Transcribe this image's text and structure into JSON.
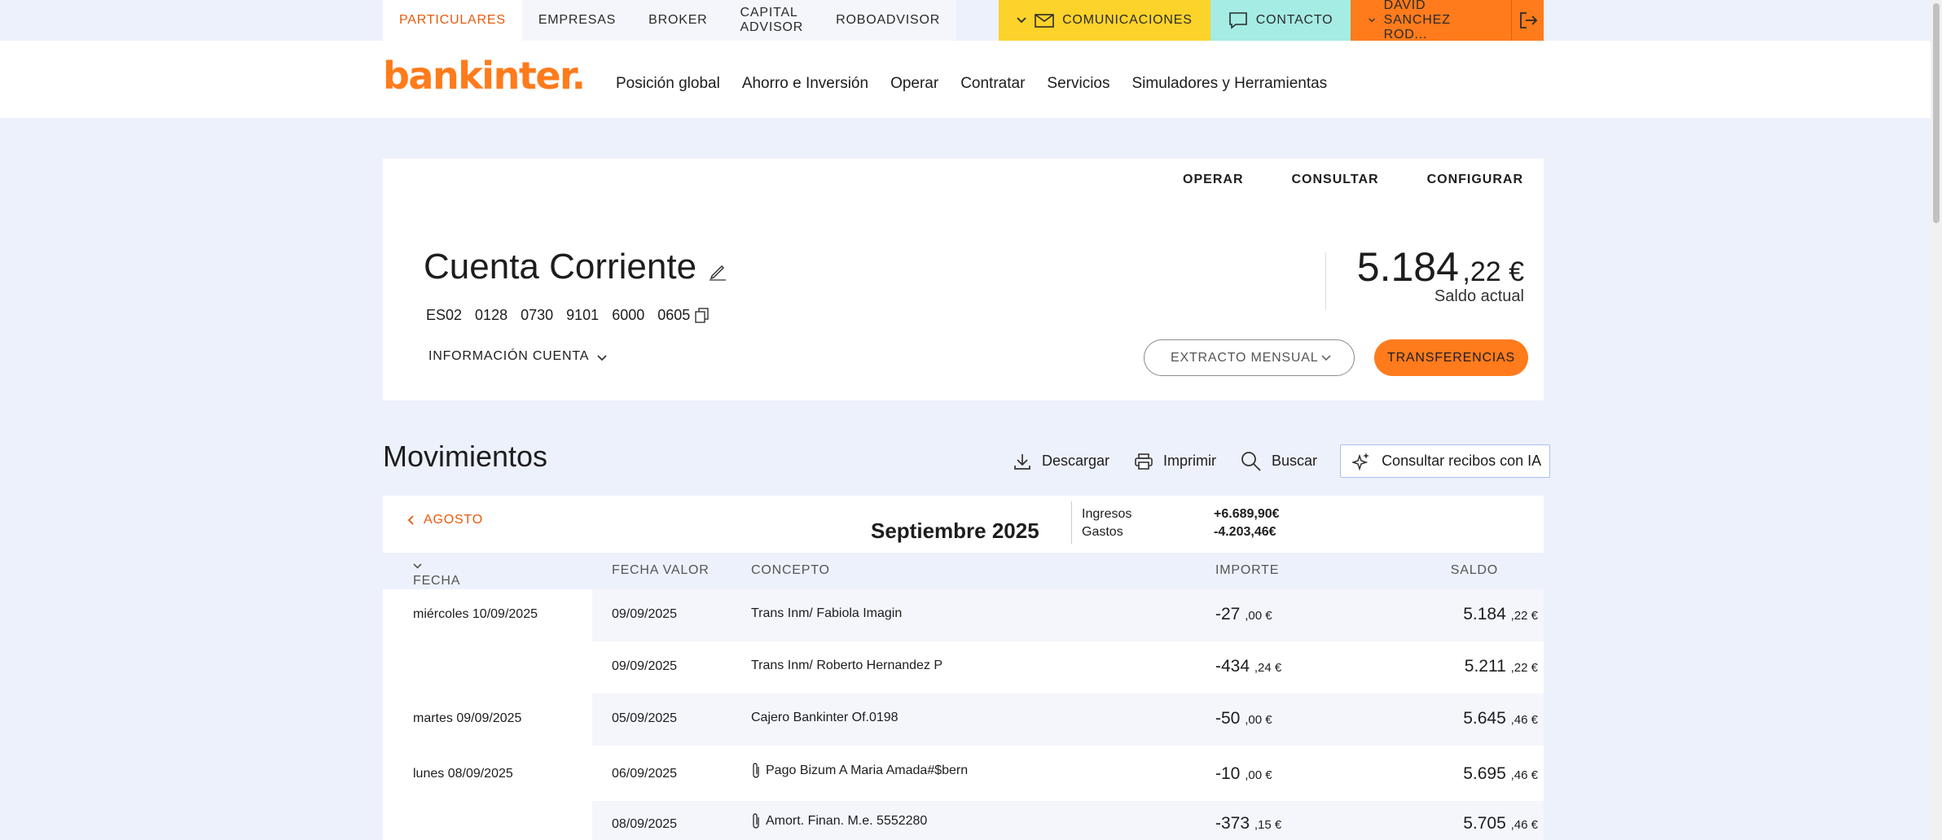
{
  "topnav": {
    "segments": [
      "PARTICULARES",
      "EMPRESAS",
      "BROKER",
      "CAPITAL ADVISOR",
      "ROBOADVISOR"
    ],
    "comunicaciones": "COMUNICACIONES",
    "contacto": "CONTACTO",
    "user": "DAVID SANCHEZ ROD..."
  },
  "header": {
    "logo": "bankinter.",
    "nav": [
      "Posición global",
      "Ahorro e Inversión",
      "Operar",
      "Contratar",
      "Servicios",
      "Simuladores y Herramientas"
    ]
  },
  "account": {
    "tabs": [
      "OPERAR",
      "CONSULTAR",
      "CONFIGURAR"
    ],
    "title": "Cuenta Corriente",
    "iban": [
      "ES02",
      "0128",
      "0730",
      "9101",
      "6000",
      "0605"
    ],
    "info_label": "INFORMACIÓN CUENTA",
    "balance_int": "5.184",
    "balance_dec": ",22 €",
    "balance_label": "Saldo actual",
    "statement_label": "EXTRACTO MENSUAL",
    "transfer_label": "TRANSFERENCIAS"
  },
  "movements": {
    "title": "Movimientos",
    "download": "Descargar",
    "print": "Imprimir",
    "search": "Buscar",
    "ia": "Consultar recibos con IA",
    "prev_month": "AGOSTO",
    "month": "Septiembre 2025",
    "income_label": "Ingresos",
    "income_value": "+6.689,90€",
    "expense_label": "Gastos",
    "expense_value": "-4.203,46€",
    "columns": {
      "fecha_contable": "FECHA CONTABLE",
      "fecha_valor": "FECHA VALOR",
      "concepto": "CONCEPTO",
      "importe": "IMPORTE",
      "saldo": "SALDO"
    },
    "rows": [
      {
        "group": "miércoles 10/09/2025",
        "valor": "09/09/2025",
        "concepto": "Trans Inm/ Fabiola Imagin",
        "amt_int": "-27",
        "amt_dec": ",00 €",
        "bal_int": "5.184",
        "bal_dec": ",22 €",
        "clip": false
      },
      {
        "group": "",
        "valor": "09/09/2025",
        "concepto": "Trans Inm/ Roberto Hernandez P",
        "amt_int": "-434",
        "amt_dec": ",24 €",
        "bal_int": "5.211",
        "bal_dec": ",22 €",
        "clip": false
      },
      {
        "group": "martes 09/09/2025",
        "valor": "05/09/2025",
        "concepto": "Cajero Bankinter Of.0198",
        "amt_int": "-50",
        "amt_dec": ",00 €",
        "bal_int": "5.645",
        "bal_dec": ",46 €",
        "clip": false
      },
      {
        "group": "lunes 08/09/2025",
        "valor": "06/09/2025",
        "concepto": "Pago Bizum A Maria Amada#$bern",
        "amt_int": "-10",
        "amt_dec": ",00 €",
        "bal_int": "5.695",
        "bal_dec": ",46 €",
        "clip": true
      },
      {
        "group": "",
        "valor": "08/09/2025",
        "concepto": "Amort. Finan. M.e. 5552280",
        "amt_int": "-373",
        "amt_dec": ",15 €",
        "bal_int": "5.705",
        "bal_dec": ",46 €",
        "clip": true
      }
    ]
  }
}
